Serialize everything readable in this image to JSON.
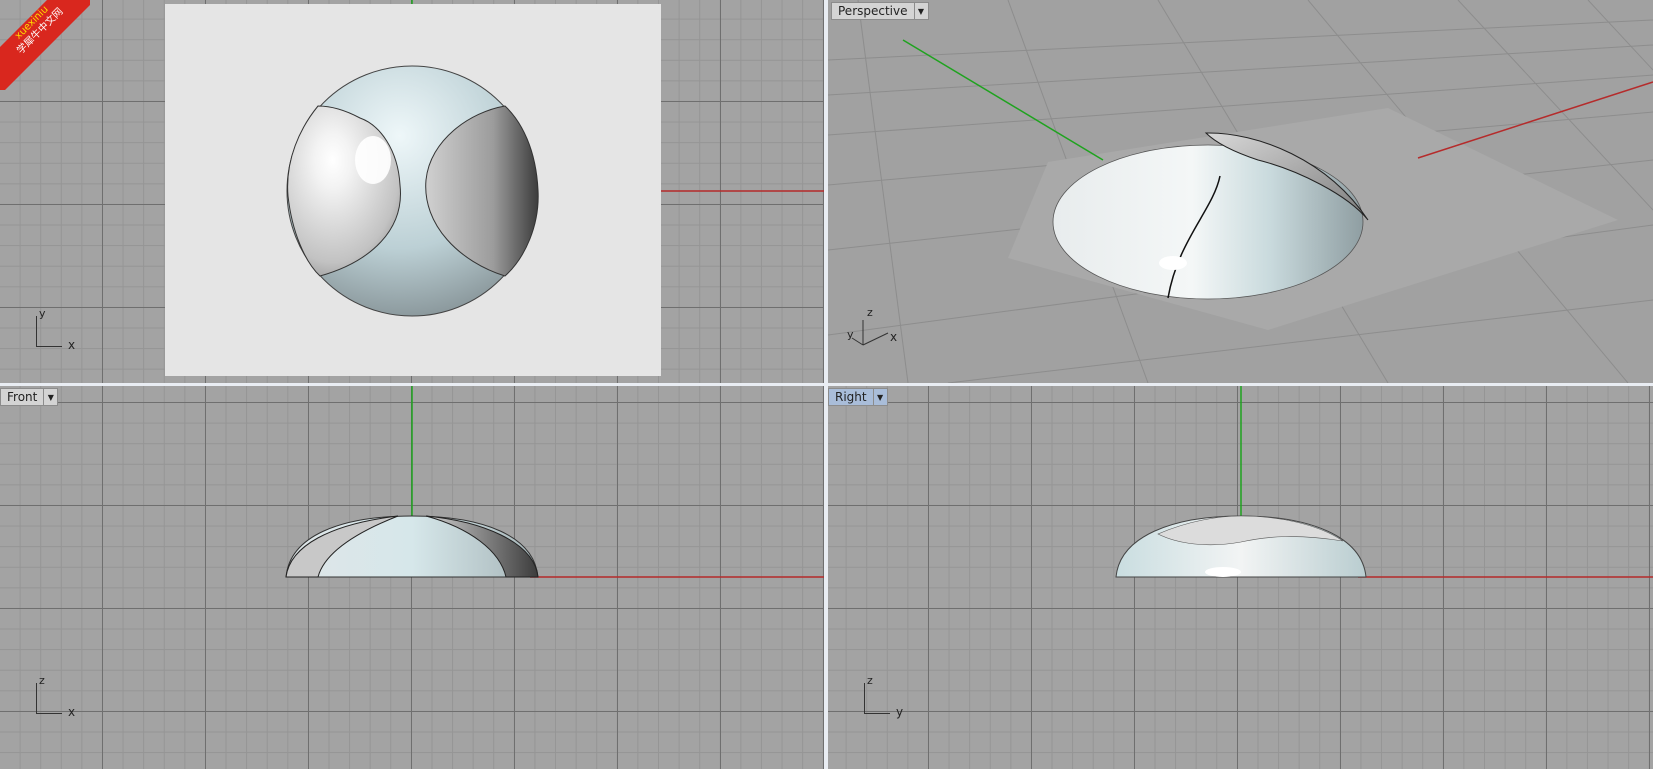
{
  "watermark": {
    "line1": "xuexiniu",
    "line2": "学犀牛中文网"
  },
  "viewports": {
    "top": {
      "axis_h": "x",
      "axis_v": "y"
    },
    "perspective": {
      "label": "Perspective",
      "axis_z": "z",
      "axis_x": "x",
      "axis_y": "y"
    },
    "front": {
      "label": "Front",
      "axis_h": "x",
      "axis_v": "z"
    },
    "right": {
      "label": "Right",
      "axis_h": "y",
      "axis_v": "z"
    }
  },
  "icons": {
    "dropdown": "chevron-down-icon"
  },
  "colors": {
    "viewport_bg": "#a3a3a3",
    "x_axis": "#b52b2b",
    "y_axis": "#1fa31f",
    "active_label": "#a9bdd9"
  }
}
